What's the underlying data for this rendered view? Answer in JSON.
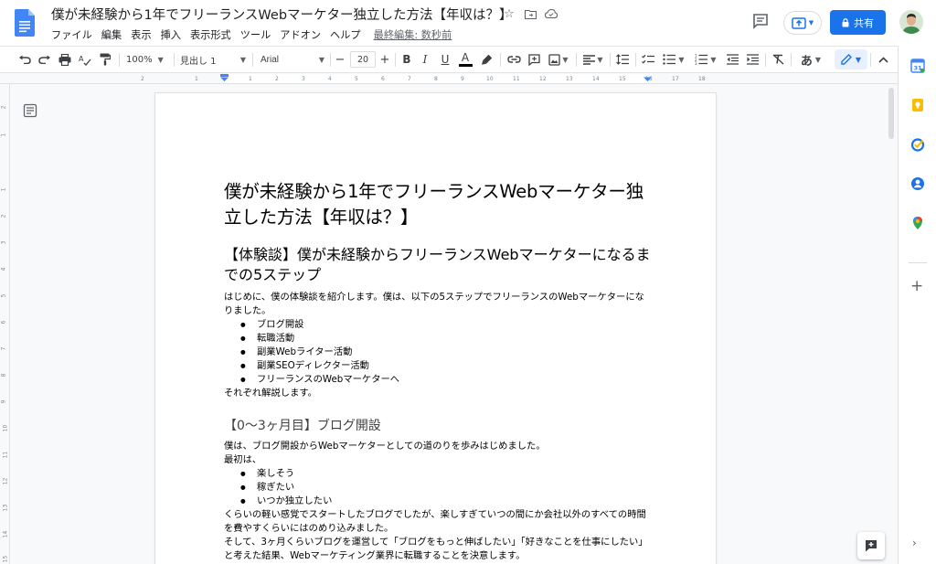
{
  "document": {
    "title": "僕が未経験から1年でフリーランスWebマーケター独立した方法【年収は？】"
  },
  "menu": {
    "items": [
      "ファイル",
      "編集",
      "表示",
      "挿入",
      "表示形式",
      "ツール",
      "アドオン",
      "ヘルプ"
    ],
    "last_edit": "最終編集: 数秒前"
  },
  "header": {
    "share_label": "共有"
  },
  "toolbar": {
    "zoom": "100%",
    "style": "見出し 1",
    "font": "Arial",
    "font_size": "20",
    "input_mode": "あ"
  },
  "ruler": {
    "ticks": [
      "2",
      "1",
      "1",
      "2",
      "3",
      "4",
      "5",
      "6",
      "7",
      "8",
      "9",
      "10",
      "11",
      "12",
      "13",
      "14",
      "15",
      "16",
      "17",
      "18"
    ],
    "vticks": [
      "2",
      "1",
      "1",
      "2",
      "3",
      "4",
      "5",
      "6",
      "7",
      "8",
      "9",
      "10",
      "11",
      "12",
      "13",
      "14",
      "15"
    ]
  },
  "content": {
    "h1": "僕が未経験から1年でフリーランスWebマーケター独立した方法【年収は？】",
    "h2_1": "【体験談】僕が未経験からフリーランスWebマーケターになるまでの5ステップ",
    "intro": "はじめに、僕の体験談を紹介します。僕は、以下の5ステップでフリーランスのWebマーケターになりました。",
    "steps": [
      "ブログ開設",
      "転職活動",
      "副業Webライター活動",
      "副業SEOディレクター活動",
      "フリーランスのWebマーケターへ"
    ],
    "steps_after": "それぞれ解説します。",
    "h3_1": "【0〜3ヶ月目】ブログ開設",
    "s1_p1": "僕は、ブログ開設からWebマーケターとしての道のりを歩みはじめました。",
    "s1_p2": "最初は、",
    "s1_list": [
      "楽しそう",
      "稼ぎたい",
      "いつか独立したい"
    ],
    "s1_p3": "くらいの軽い感覚でスタートしたブログでしたが、楽しすぎていつの間にか会社以外のすべての時間を費やすくらいにはのめり込みました。",
    "s1_p4": "そして、3ヶ月くらいブログを運営して「ブログをもっと伸ばしたい」「好きなことを仕事にしたい」と考えた結果、Webマーケティング業界に転職することを決意します。"
  },
  "colors": {
    "accent": "#1a73e8",
    "docs_blue": "#4285f4"
  }
}
